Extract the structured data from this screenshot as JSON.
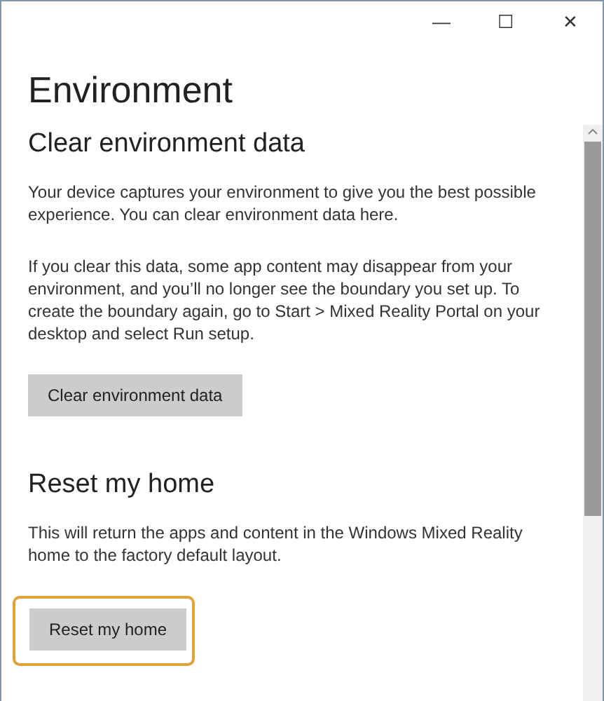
{
  "window": {
    "controls": [
      "—",
      "☐",
      "✕"
    ]
  },
  "title": "Environment",
  "sections": [
    {
      "heading": "Clear environment data",
      "paragraphs": [
        "Your device captures your environment to give you the best possible experience. You can clear environment data here.",
        "If you clear this data, some app content may disappear from your environment, and you’ll no longer see the boundary you set up. To create the boundary again, go to Start > Mixed Reality Portal on your desktop and select Run setup."
      ],
      "button": {
        "label": "Clear environment data",
        "highlighted": false
      }
    },
    {
      "heading": "Reset my home",
      "paragraphs": [
        "This will return the apps and content in the Windows Mixed Reality home to the factory default layout."
      ],
      "button": {
        "label": "Reset my home",
        "highlighted": true
      }
    }
  ]
}
